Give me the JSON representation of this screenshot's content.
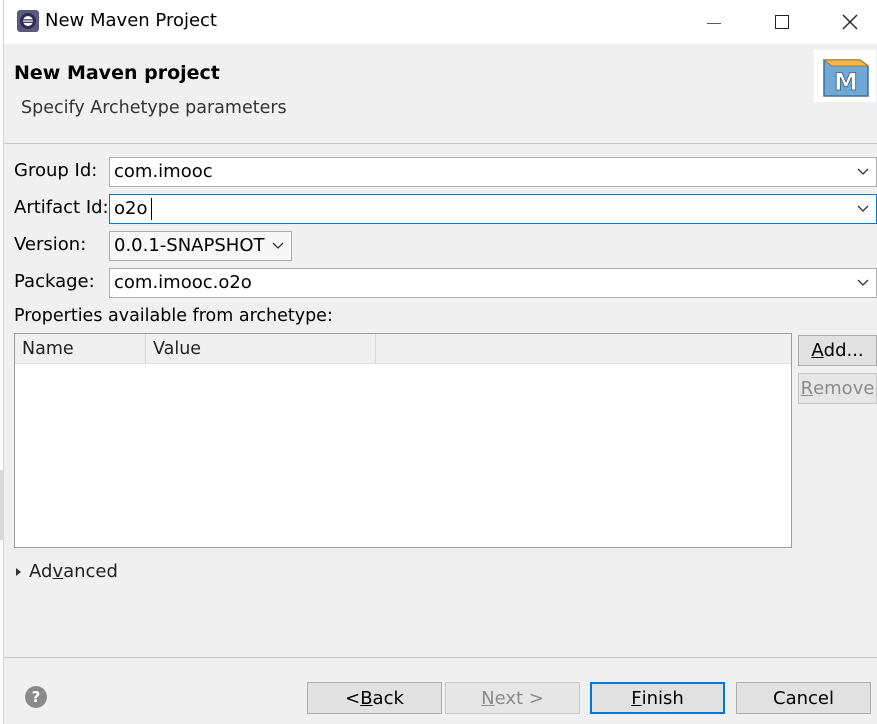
{
  "window": {
    "title": "New Maven Project"
  },
  "banner": {
    "title": "New Maven project",
    "subtitle": "Specify Archetype parameters"
  },
  "form": {
    "group_id": {
      "label": "Group Id:",
      "value": "com.imooc"
    },
    "artifact_id": {
      "label": "Artifact Id:",
      "value": "o2o"
    },
    "version": {
      "label": "Version:",
      "value": "0.0.1-SNAPSHOT"
    },
    "package": {
      "label": "Package:",
      "value": "com.imooc.o2o"
    }
  },
  "properties": {
    "label": "Properties available from archetype:",
    "columns": [
      "Name",
      "Value"
    ],
    "rows": [],
    "add_button": {
      "before": "",
      "mnemonic": "A",
      "after": "dd..."
    },
    "remove_button": {
      "before": "",
      "mnemonic": "R",
      "after": "emove"
    }
  },
  "advanced": {
    "before": "Ad",
    "mnemonic": "v",
    "after": "anced"
  },
  "footer": {
    "back": {
      "before": "< ",
      "mnemonic": "B",
      "after": "ack"
    },
    "next": {
      "before": "",
      "mnemonic": "N",
      "after": "ext >"
    },
    "finish": {
      "before": "",
      "mnemonic": "F",
      "after": "inish"
    },
    "cancel": "Cancel"
  },
  "icons": {
    "app": "eclipse-icon",
    "logo": "maven-logo-icon",
    "logo_letter": "M",
    "help": "help-icon",
    "help_glyph": "?"
  },
  "colors": {
    "accent": "#0078d7",
    "background": "#f0f0f0",
    "disabled_text": "#8a8a8a"
  }
}
